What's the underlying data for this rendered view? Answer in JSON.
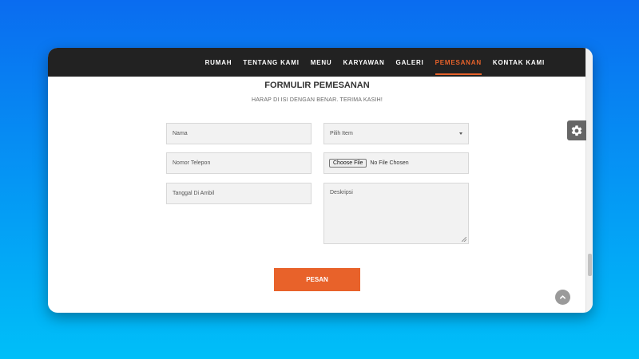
{
  "nav": {
    "items": [
      "RUMAH",
      "TENTANG KAMI",
      "MENU",
      "KARYAWAN",
      "GALERI",
      "PEMESANAN",
      "KONTAK KAMI"
    ],
    "active_index": 5,
    "active_color": "#e8622a",
    "background": "#222222"
  },
  "form": {
    "title": "FORMULIR PEMESANAN",
    "subtitle": "HARAP DI ISI DENGAN BENAR. TERIMA KASIH!",
    "name_placeholder": "Nama",
    "item_select_value": "Pilih Item",
    "phone_placeholder": "Nomor Telepon",
    "file_button": "Choose File",
    "file_status": "No File Chosen",
    "pickup_date_placeholder": "Tanggal Di Ambil",
    "description_placeholder": "Deskripsi",
    "submit_label": "PESAN"
  },
  "icons": {
    "settings": "gear-icon",
    "scroll_top": "chevron-up-icon"
  },
  "colors": {
    "accent": "#e8622a",
    "settings_tab": "#666666"
  }
}
